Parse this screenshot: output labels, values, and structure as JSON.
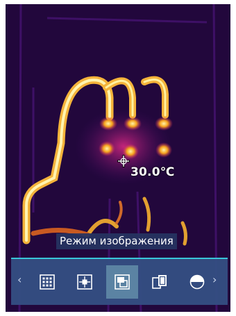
{
  "measurement": {
    "temperature": "30.0℃"
  },
  "image_mode": {
    "label": "Режим изображения",
    "options": [
      {
        "icon": "thermal-only-icon",
        "active": false
      },
      {
        "icon": "picture-in-picture-icon",
        "active": false
      },
      {
        "icon": "blending-icon",
        "active": true
      },
      {
        "icon": "side-by-side-icon",
        "active": false
      },
      {
        "icon": "visual-only-icon",
        "active": false
      }
    ]
  },
  "navigation": {
    "prev_symbol": "‹",
    "next_symbol": "›"
  },
  "colors": {
    "toolbar_bg": "#344e82",
    "toolbar_border": "#39c6d8",
    "active_tool_bg": "#6996af"
  }
}
